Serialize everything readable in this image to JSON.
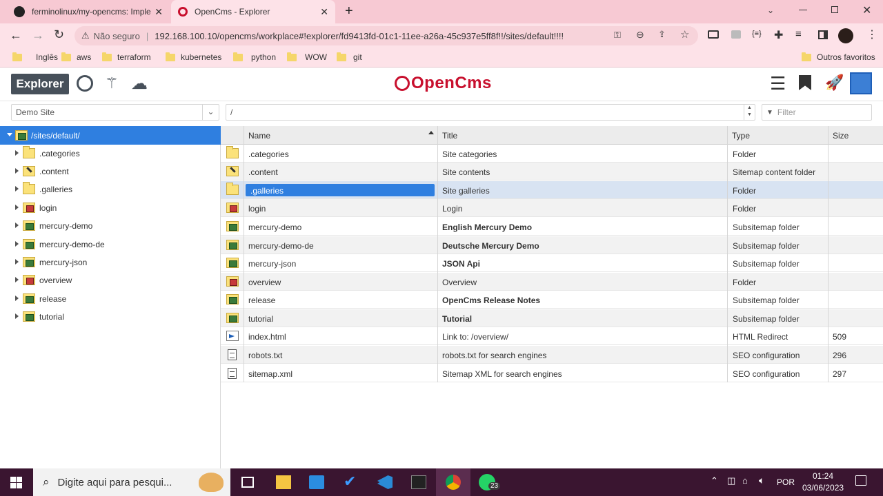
{
  "browser": {
    "tabs": [
      {
        "title": "ferminolinux/my-opencms: Imple",
        "active": false
      },
      {
        "title": "OpenCms - Explorer",
        "active": true
      }
    ],
    "security_label": "Não seguro",
    "url": "192.168.100.10/opencms/workplace#!explorer/fd9413fd-01c1-11ee-a26a-45c937e5ff8f!!/sites/default!!!!",
    "bookmarks": [
      "Inglês",
      "aws",
      "terraform",
      "kubernetes",
      "python",
      "WOW",
      "git"
    ],
    "other_bookmarks": "Outros favoritos"
  },
  "app": {
    "explorer_label": "Explorer",
    "logo_text": "OpenCms",
    "site_select": "Demo Site",
    "path_value": "/",
    "filter_placeholder": "Filter"
  },
  "tree": {
    "root": "/sites/default/",
    "items": [
      {
        "label": ".categories",
        "icon": "folder"
      },
      {
        "label": ".content",
        "icon": "content"
      },
      {
        "label": ".galleries",
        "icon": "folder"
      },
      {
        "label": "login",
        "icon": "login"
      },
      {
        "label": "mercury-demo",
        "icon": "subsite"
      },
      {
        "label": "mercury-demo-de",
        "icon": "subsite"
      },
      {
        "label": "mercury-json",
        "icon": "subsite"
      },
      {
        "label": "overview",
        "icon": "login"
      },
      {
        "label": "release",
        "icon": "subsite"
      },
      {
        "label": "tutorial",
        "icon": "subsite"
      }
    ]
  },
  "table": {
    "columns": {
      "name": "Name",
      "title": "Title",
      "type": "Type",
      "size": "Size"
    },
    "rows": [
      {
        "name": ".categories",
        "title": "Site categories",
        "type": "Folder",
        "size": "",
        "icon": "folder",
        "bold": false
      },
      {
        "name": ".content",
        "title": "Site contents",
        "type": "Sitemap content folder",
        "size": "",
        "icon": "content",
        "bold": false
      },
      {
        "name": ".galleries",
        "title": "Site galleries",
        "type": "Folder",
        "size": "",
        "icon": "folder",
        "bold": false,
        "selected": true
      },
      {
        "name": "login",
        "title": "Login",
        "type": "Folder",
        "size": "",
        "icon": "login",
        "bold": false
      },
      {
        "name": "mercury-demo",
        "title": "English Mercury Demo",
        "type": "Subsitemap folder",
        "size": "",
        "icon": "subsite",
        "bold": true
      },
      {
        "name": "mercury-demo-de",
        "title": "Deutsche Mercury Demo",
        "type": "Subsitemap folder",
        "size": "",
        "icon": "subsite",
        "bold": true
      },
      {
        "name": "mercury-json",
        "title": "JSON Api",
        "type": "Subsitemap folder",
        "size": "",
        "icon": "subsite",
        "bold": true
      },
      {
        "name": "overview",
        "title": "Overview",
        "type": "Folder",
        "size": "",
        "icon": "login",
        "bold": false
      },
      {
        "name": "release",
        "title": "OpenCms Release Notes",
        "type": "Subsitemap folder",
        "size": "",
        "icon": "subsite",
        "bold": true
      },
      {
        "name": "tutorial",
        "title": "Tutorial",
        "type": "Subsitemap folder",
        "size": "",
        "icon": "subsite",
        "bold": true
      },
      {
        "name": "index.html",
        "title": "Link to: /overview/",
        "type": "HTML Redirect",
        "size": "509",
        "icon": "redirect",
        "bold": false
      },
      {
        "name": "robots.txt",
        "title": "robots.txt for search engines",
        "type": "SEO configuration",
        "size": "296",
        "icon": "text",
        "bold": false
      },
      {
        "name": "sitemap.xml",
        "title": "Sitemap XML for search engines",
        "type": "SEO configuration",
        "size": "297",
        "icon": "text",
        "bold": false
      }
    ]
  },
  "taskbar": {
    "search_placeholder": "Digite aqui para pesqui...",
    "whatsapp_badge": "23",
    "language": "POR",
    "time": "01:24",
    "date": "03/06/2023"
  },
  "colors": {
    "selection": "#2f7fe0",
    "tab_strip": "#f7c9d3",
    "taskbar": "#3a1530",
    "logo_red": "#c8102e"
  }
}
